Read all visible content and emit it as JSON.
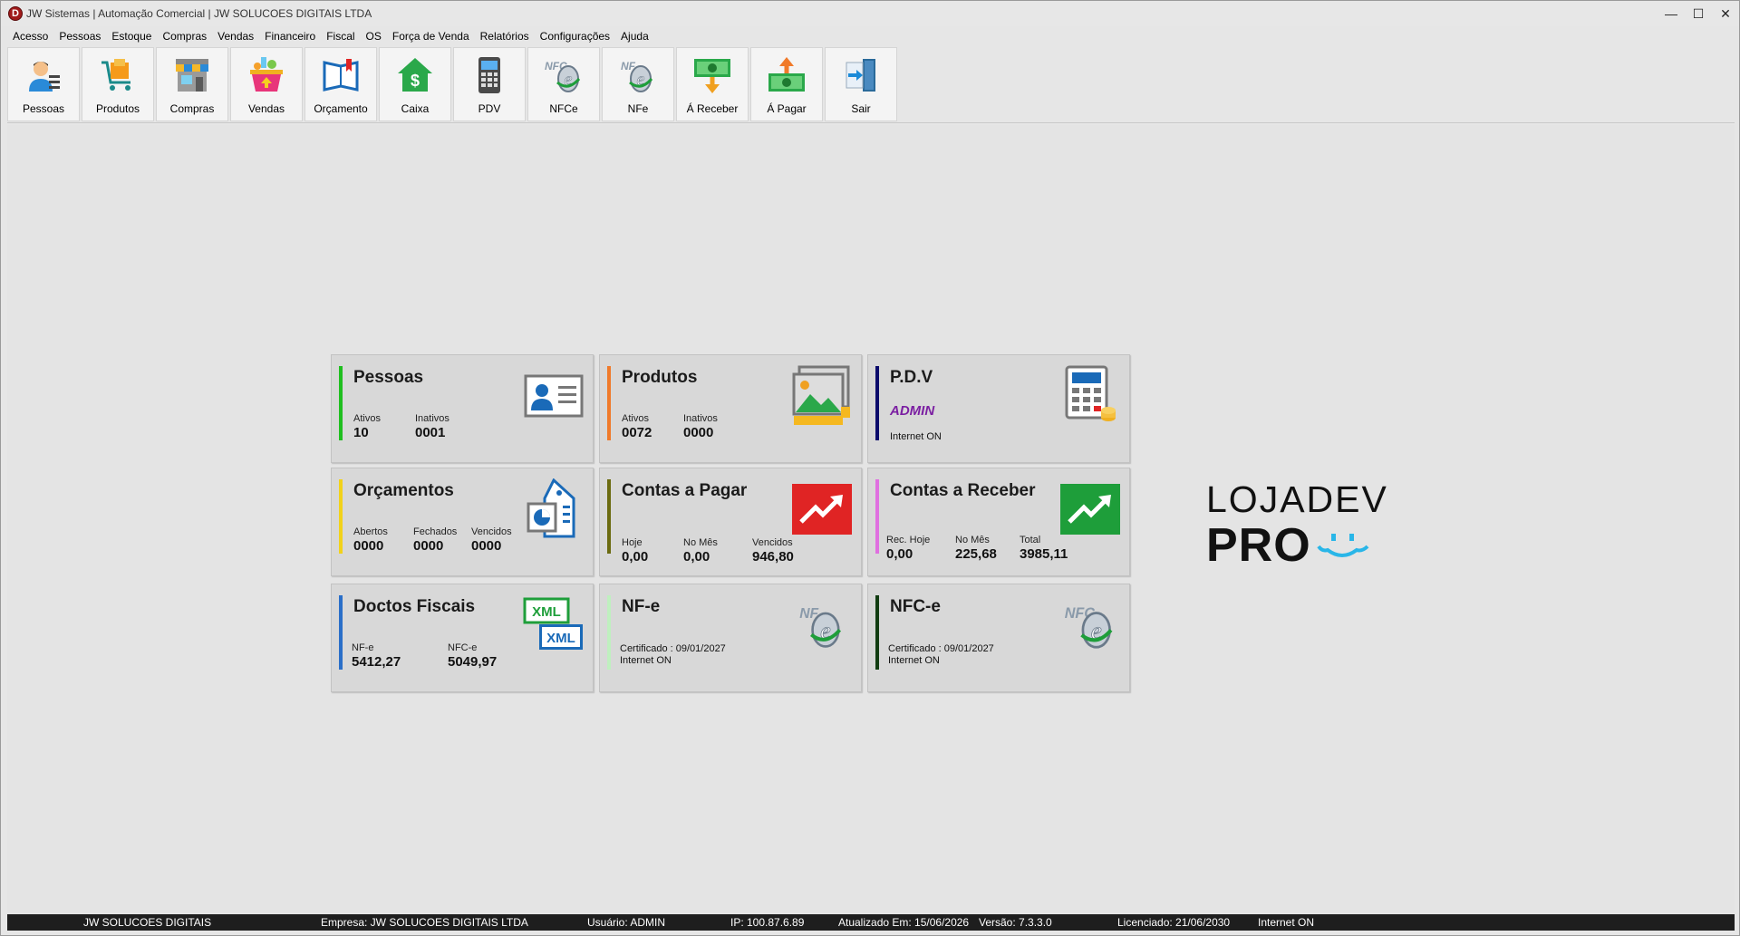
{
  "window": {
    "app_letter": "D",
    "title": "JW Sistemas | Automação Comercial | JW SOLUCOES DIGITAIS LTDA",
    "controls": [
      "—",
      "☐",
      "✕"
    ]
  },
  "menu": [
    "Acesso",
    "Pessoas",
    "Estoque",
    "Compras",
    "Vendas",
    "Financeiro",
    "Fiscal",
    "OS",
    "Força de Venda",
    "Relatórios",
    "Configurações",
    "Ajuda"
  ],
  "toolbar": [
    {
      "label": "Pessoas",
      "icon": "person-icon"
    },
    {
      "label": "Produtos",
      "icon": "cart-icon"
    },
    {
      "label": "Compras",
      "icon": "store-icon"
    },
    {
      "label": "Vendas",
      "icon": "basket-icon"
    },
    {
      "label": "Orçamento",
      "icon": "book-icon"
    },
    {
      "label": "Caixa",
      "icon": "cash-house-icon"
    },
    {
      "label": "PDV",
      "icon": "pos-terminal-icon"
    },
    {
      "label": "NFCe",
      "icon": "nfce-icon"
    },
    {
      "label": "NFe",
      "icon": "nfe-icon"
    },
    {
      "label": "Á Receber",
      "icon": "money-in-icon"
    },
    {
      "label": "Á Pagar",
      "icon": "money-out-icon"
    },
    {
      "label": "Sair",
      "icon": "exit-icon"
    }
  ],
  "cards": {
    "pessoas": {
      "title": "Pessoas",
      "bar_color": "#1fbf1f",
      "ativos_label": "Ativos",
      "ativos": "10",
      "inativos_label": "Inativos",
      "inativos": "0001"
    },
    "produtos": {
      "title": "Produtos",
      "bar_color": "#f07a2a",
      "ativos_label": "Ativos",
      "ativos": "0072",
      "inativos_label": "Inativos",
      "inativos": "0000"
    },
    "pdv": {
      "title": "P.D.V",
      "bar_color": "#0b0b6b",
      "user": "ADMIN",
      "internet": "Internet ON"
    },
    "orcamentos": {
      "title": "Orçamentos",
      "bar_color": "#f2d21a",
      "abertos_label": "Abertos",
      "abertos": "0000",
      "fechados_label": "Fechados",
      "fechados": "0000",
      "vencidos_label": "Vencidos",
      "vencidos": "0000"
    },
    "pagar": {
      "title": "Contas a Pagar",
      "bar_color": "#6b6b10",
      "hoje_label": "Hoje",
      "hoje": "0,00",
      "mes_label": "No Mês",
      "mes": "0,00",
      "vencidos_label": "Vencidos",
      "vencidos": "946,80"
    },
    "receber": {
      "title": "Contas a Receber",
      "bar_color": "#e070e0",
      "hoje_label": "Rec. Hoje",
      "hoje": "0,00",
      "mes_label": "No Mês",
      "mes": "225,68",
      "total_label": "Total",
      "total": "3985,11"
    },
    "docs": {
      "title": "Doctos Fiscais",
      "bar_color": "#2a6fc9",
      "nfe_label": "NF-e",
      "nfe": "5412,27",
      "nfce_label": "NFC-e",
      "nfce": "5049,97"
    },
    "nfe": {
      "title": "NF-e",
      "bar_color": "#bff0bf",
      "cert": "Certificado : 09/01/2027",
      "internet": "Internet ON"
    },
    "nfce": {
      "title": "NFC-e",
      "bar_color": "#123d12",
      "cert": "Certificado : 09/01/2027",
      "internet": "Internet ON"
    }
  },
  "logo": {
    "line1": "LOJADEV",
    "line2": "PRO"
  },
  "status": {
    "company": "JW SOLUCOES DIGITAIS",
    "empresa": "Empresa: JW SOLUCOES DIGITAIS LTDA",
    "usuario": "Usuário: ADMIN",
    "ip": "IP: 100.87.6.89",
    "atualizado": "Atualizado Em: 15/06/2026",
    "versao": "Versão: 7.3.3.0",
    "licenciado": "Licenciado: 21/06/2030",
    "internet": "Internet ON"
  },
  "colors": {
    "accent_red": "#e02424",
    "accent_green": "#1e9e3a",
    "accent_blue": "#2a6fc9",
    "admin_purple": "#7b1fa2"
  }
}
